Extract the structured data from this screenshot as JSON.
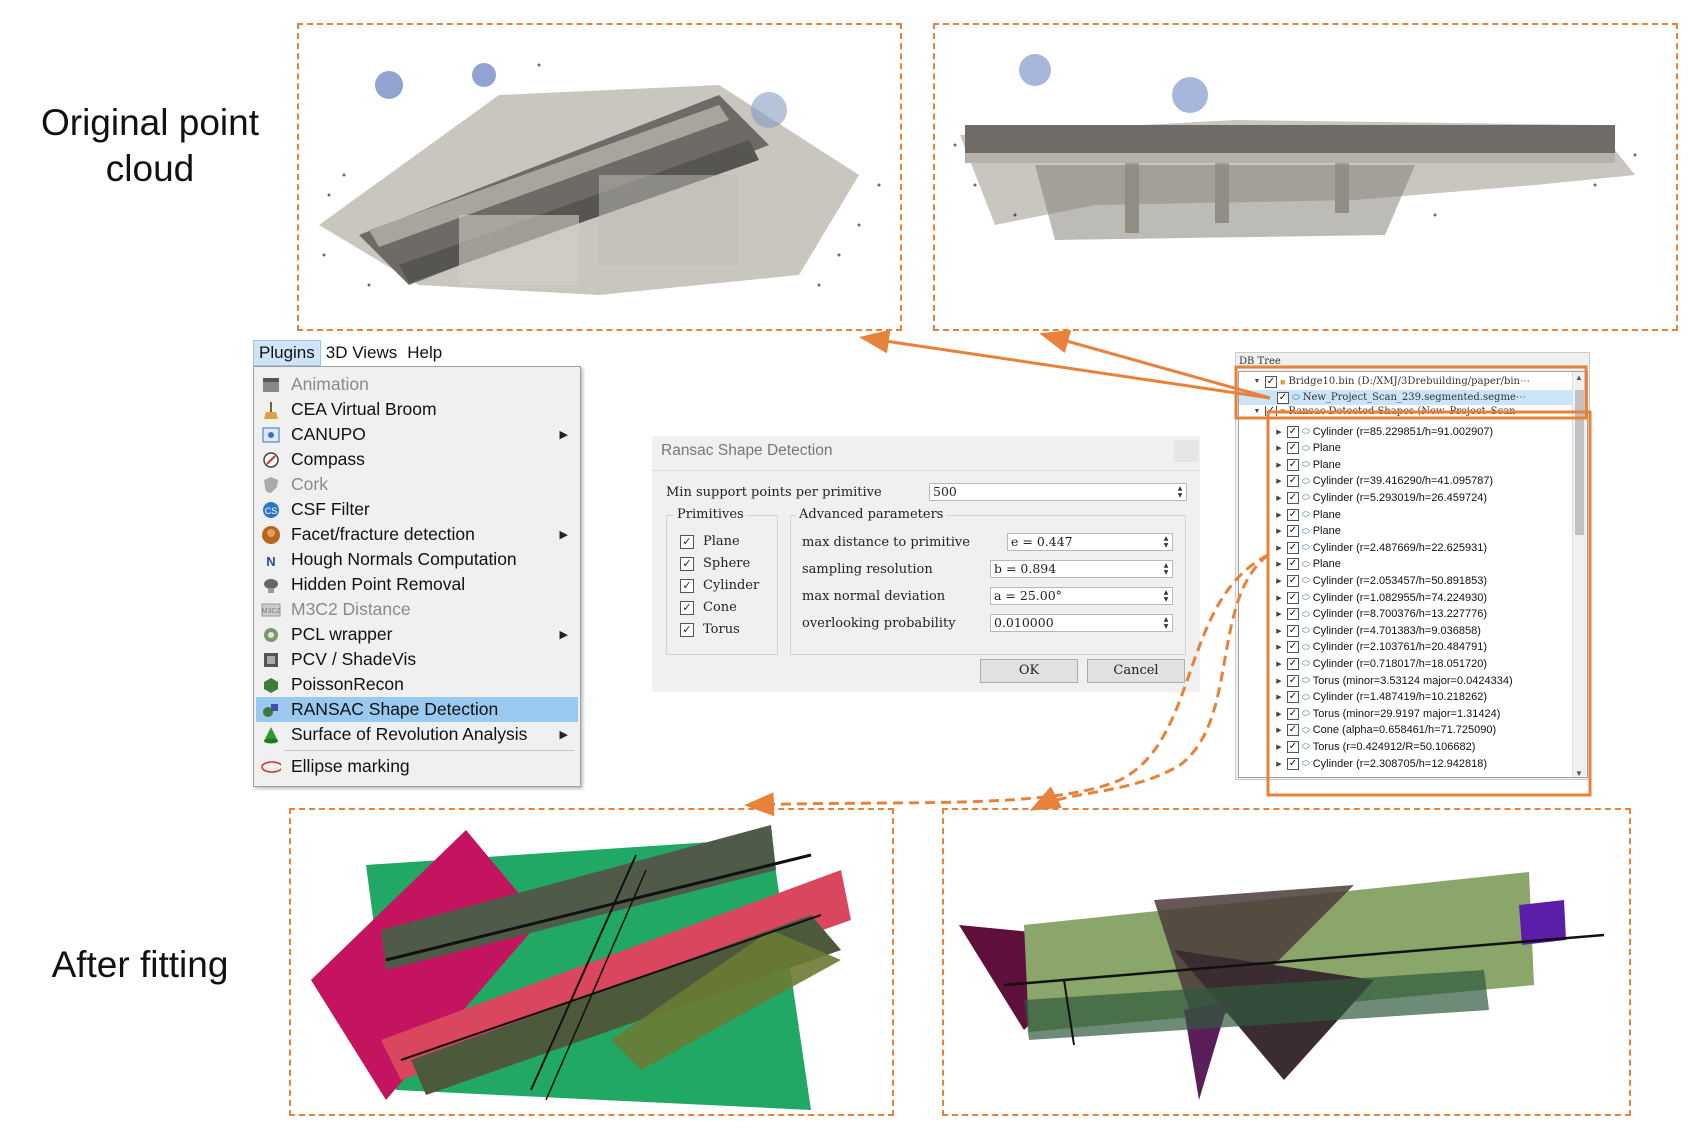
{
  "labels": {
    "top": "Original point\ncloud",
    "bottom": "After fitting"
  },
  "menubar": {
    "items": [
      "Plugins",
      "3D Views",
      "Help"
    ]
  },
  "plugins_menu": {
    "items": [
      {
        "label": "Animation",
        "icon": "clapperboard-icon",
        "disabled": true
      },
      {
        "label": "CEA Virtual Broom",
        "icon": "broom-icon"
      },
      {
        "label": "CANUPO",
        "icon": "canupo-icon",
        "submenu": true
      },
      {
        "label": "Compass",
        "icon": "compass-icon"
      },
      {
        "label": "Cork",
        "icon": "shield-icon",
        "disabled": true
      },
      {
        "label": "CSF Filter",
        "icon": "csf-icon"
      },
      {
        "label": "Facet/fracture detection",
        "icon": "facet-icon",
        "submenu": true
      },
      {
        "label": "Hough Normals Computation",
        "icon": "normals-icon"
      },
      {
        "label": "Hidden Point Removal",
        "icon": "hpr-icon"
      },
      {
        "label": "M3C2 Distance",
        "icon": "m3c2-icon",
        "disabled": true
      },
      {
        "label": "PCL wrapper",
        "icon": "pcl-icon",
        "submenu": true
      },
      {
        "label": "PCV / ShadeVis",
        "icon": "pcv-icon"
      },
      {
        "label": "PoissonRecon",
        "icon": "poisson-icon"
      },
      {
        "label": "RANSAC Shape Detection",
        "icon": "ransac-icon",
        "selected": true
      },
      {
        "label": "Surface of Revolution Analysis",
        "icon": "cone-icon",
        "submenu": true
      },
      {
        "label": "Ellipse marking",
        "icon": "ellipse-icon"
      }
    ]
  },
  "ransac_dialog": {
    "title": "Ransac Shape Detection",
    "min_support_label": "Min support points per primitive",
    "min_support_value": "500",
    "primitives_title": "Primitives",
    "primitives": [
      "Plane",
      "Sphere",
      "Cylinder",
      "Cone",
      "Torus"
    ],
    "advanced_title": "Advanced parameters",
    "params": [
      {
        "label": "max distance to primitive",
        "value": "e = 0.447"
      },
      {
        "label": "sampling resolution",
        "value": "b = 0.894"
      },
      {
        "label": "max normal deviation",
        "value": "a = 25.00°"
      },
      {
        "label": "overlooking probability",
        "value": "0.010000"
      }
    ],
    "ok": "OK",
    "cancel": "Cancel"
  },
  "db_tree": {
    "title": "DB Tree",
    "root": "Bridge10.bin (D:/XMJ/3Drebuilding/paper/bin⋯",
    "cloud": "New_Project_Scan_239.segmented.segme⋯",
    "group": "Ransac Detected Shapes (New_Project_Scan_⋯",
    "items": [
      "Cylinder (r=85.229851/h=91.002907)",
      "Plane",
      "Plane",
      "Cylinder (r=39.416290/h=41.095787)",
      "Cylinder (r=5.293019/h=26.459724)",
      "Plane",
      "Plane",
      "Cylinder (r=2.487669/h=22.625931)",
      "Plane",
      "Cylinder (r=2.053457/h=50.891853)",
      "Cylinder (r=1.082955/h=74.224930)",
      "Cylinder (r=8.700376/h=13.227776)",
      "Cylinder (r=4.701383/h=9.036858)",
      "Cylinder (r=2.103761/h=20.484791)",
      "Cylinder (r=0.718017/h=18.051720)",
      "Torus (minor=3.53124 major=0.0424334)",
      "Cylinder (r=1.487419/h=10.218262)",
      "Torus (minor=29.9197 major=1.31424)",
      "Cone (alpha=0.658461/h=71.725090)",
      "Torus (r=0.424912/R=50.106682)",
      "Cylinder (r=2.308705/h=12.942818)"
    ]
  },
  "colors": {
    "accent_orange": "#e8823a",
    "menu_highlight": "#99c9ef"
  }
}
